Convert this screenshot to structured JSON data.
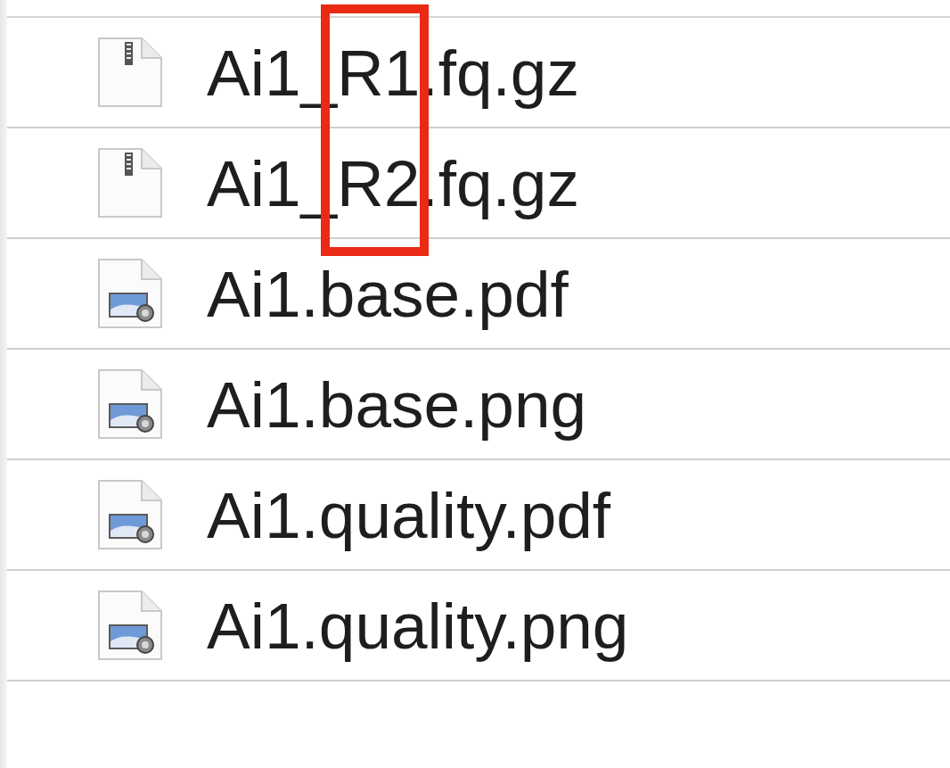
{
  "files": [
    {
      "name": "Ai1_R1.fq.gz",
      "kind": "archive"
    },
    {
      "name": "Ai1_R2.fq.gz",
      "kind": "archive"
    },
    {
      "name": "Ai1.base.pdf",
      "kind": "image"
    },
    {
      "name": "Ai1.base.png",
      "kind": "image"
    },
    {
      "name": "Ai1.quality.pdf",
      "kind": "image"
    },
    {
      "name": "Ai1.quality.png",
      "kind": "image"
    }
  ]
}
